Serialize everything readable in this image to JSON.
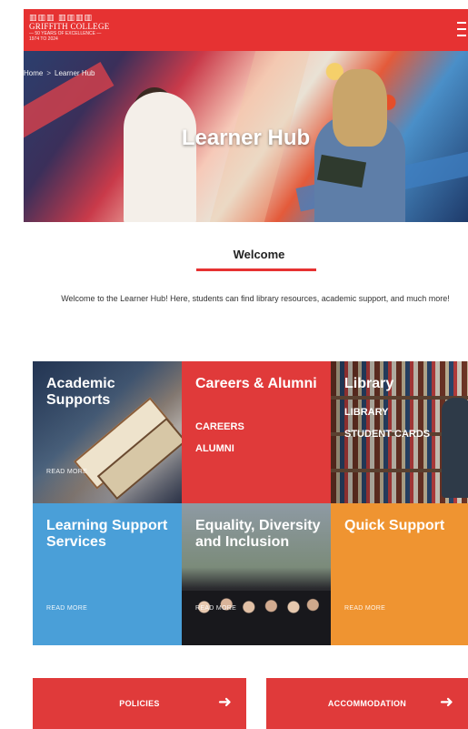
{
  "header": {
    "logo_crest": "▥▥▥ ▥▥▥▥",
    "logo_name": "GRIFFITH COLLEGE",
    "logo_tagline": "— 50 YEARS OF EXCELLENCE —",
    "logo_years": "1974 TO 2024",
    "menu_icon": "hamburger-icon"
  },
  "hero": {
    "breadcrumb_home": "Home",
    "breadcrumb_sep": ">",
    "breadcrumb_current": "Learner Hub",
    "title": "Learner Hub"
  },
  "welcome": {
    "heading": "Welcome",
    "text": "Welcome to the Learner Hub! Here, students can find library resources, academic support, and much more!"
  },
  "tiles": [
    {
      "title": "Academic Supports",
      "readmore": "READ MORE"
    },
    {
      "title": "Careers & Alumni",
      "links": [
        "CAREERS",
        "ALUMNI"
      ]
    },
    {
      "title": "Library",
      "links": [
        "LIBRARY",
        "STUDENT CARDS"
      ]
    },
    {
      "title": "Learning Support Services",
      "readmore": "READ MORE"
    },
    {
      "title": "Equality, Diversity and Inclusion",
      "readmore": "READ MORE"
    },
    {
      "title": "Quick Support",
      "readmore": "READ MORE"
    }
  ],
  "buttons": {
    "policies": "POLICIES",
    "accommodation": "ACCOMMODATION",
    "arrow": "➜"
  },
  "colors": {
    "brand_red": "#e63232",
    "learning_blue": "#4a9fd8",
    "quick_orange": "#ef9431"
  }
}
